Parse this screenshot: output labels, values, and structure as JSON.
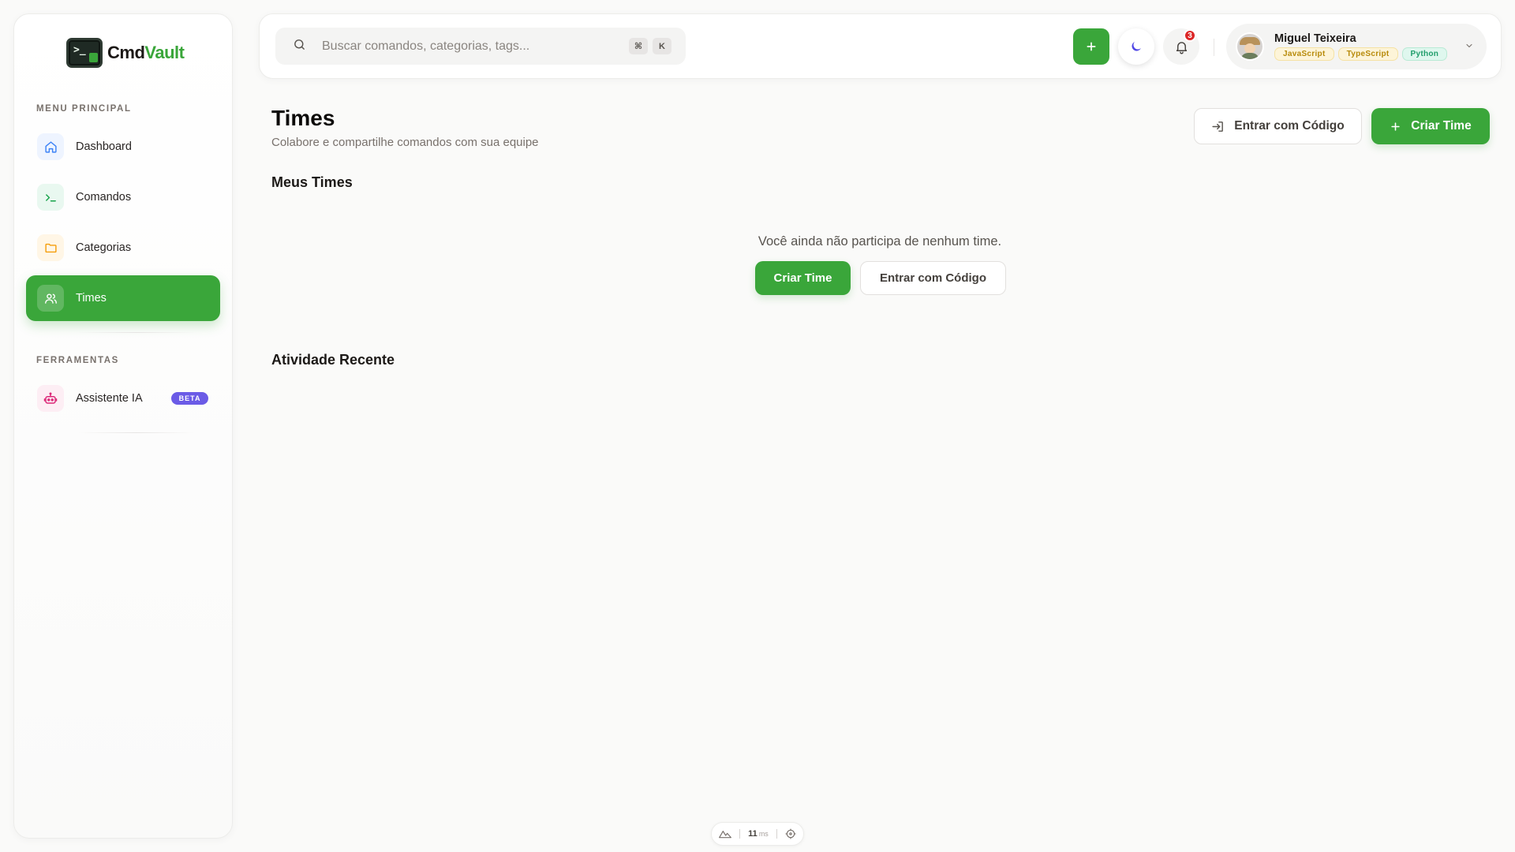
{
  "app": {
    "name_part1": "Cmd",
    "name_part2": "Vault"
  },
  "sidebar": {
    "main_label": "MENU PRINCIPAL",
    "tools_label": "FERRAMENTAS",
    "items": [
      {
        "label": "Dashboard",
        "icon": "home-icon",
        "color": "#eef4ff"
      },
      {
        "label": "Comandos",
        "icon": "terminal-icon",
        "color": "#e9f8f0"
      },
      {
        "label": "Categorias",
        "icon": "folder-icon",
        "color": "#fff6e6"
      },
      {
        "label": "Times",
        "icon": "users-icon",
        "active": true
      }
    ],
    "tools": [
      {
        "label": "Assistente IA",
        "icon": "robot-icon",
        "badge": "BETA"
      }
    ]
  },
  "header": {
    "search_placeholder": "Buscar comandos, categorias, tags...",
    "shortcut_keys": [
      "⌘",
      "K"
    ],
    "notification_count": "3",
    "user": {
      "name": "Miguel Teixeira",
      "tags": [
        "JavaScript",
        "TypeScript",
        "Python"
      ]
    }
  },
  "main": {
    "title": "Times",
    "subtitle": "Colabore e compartilhe comandos com sua equipe",
    "join_button": "Entrar com Código",
    "create_button": "Criar Time",
    "my_teams_title": "Meus Times",
    "empty_message": "Você ainda não participa de nenhum time.",
    "empty_create": "Criar Time",
    "empty_join": "Entrar com Código",
    "activity_title": "Atividade Recente"
  },
  "footer": {
    "value": "11",
    "unit": "ms"
  },
  "colors": {
    "accent": "#3aa63a",
    "beta": "#6b5be6",
    "badge": "#dc2626"
  }
}
